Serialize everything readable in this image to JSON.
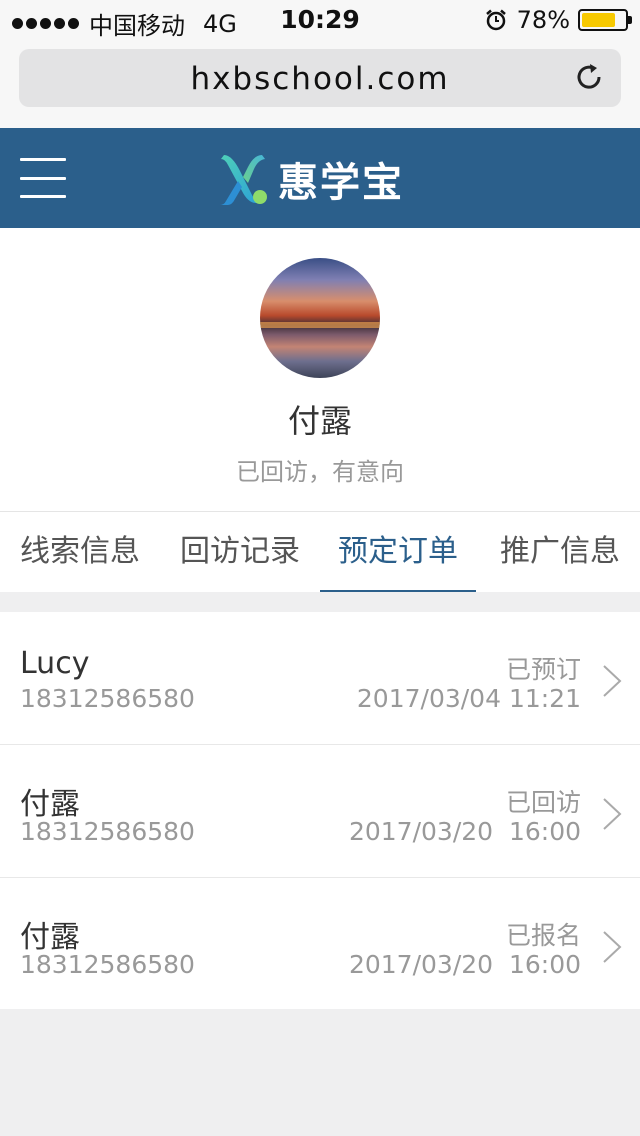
{
  "status_bar": {
    "carrier": "中国移动",
    "network": "4G",
    "time": "10:29",
    "battery": "78%",
    "battery_level": 0.78
  },
  "browser": {
    "url": "hxbschool.com"
  },
  "header": {
    "logo_text": "惠学宝",
    "brand_color": "#2b5f8b"
  },
  "profile": {
    "name": "付露",
    "status": "已回访，有意向"
  },
  "tabs": [
    {
      "label": "线索信息"
    },
    {
      "label": "回访记录"
    },
    {
      "label": "预定订单"
    },
    {
      "label": "推广信息"
    }
  ],
  "orders": [
    {
      "name": "Lucy",
      "phone": "18312586580",
      "status": "已预订",
      "datetime": "2017/03/04 11:21"
    },
    {
      "name": "付露",
      "phone": "18312586580",
      "status": "已回访",
      "datetime": "2017/03/20  16:00"
    },
    {
      "name": "付露",
      "phone": "18312586580",
      "status": "已报名",
      "datetime": "2017/03/20  16:00"
    }
  ]
}
